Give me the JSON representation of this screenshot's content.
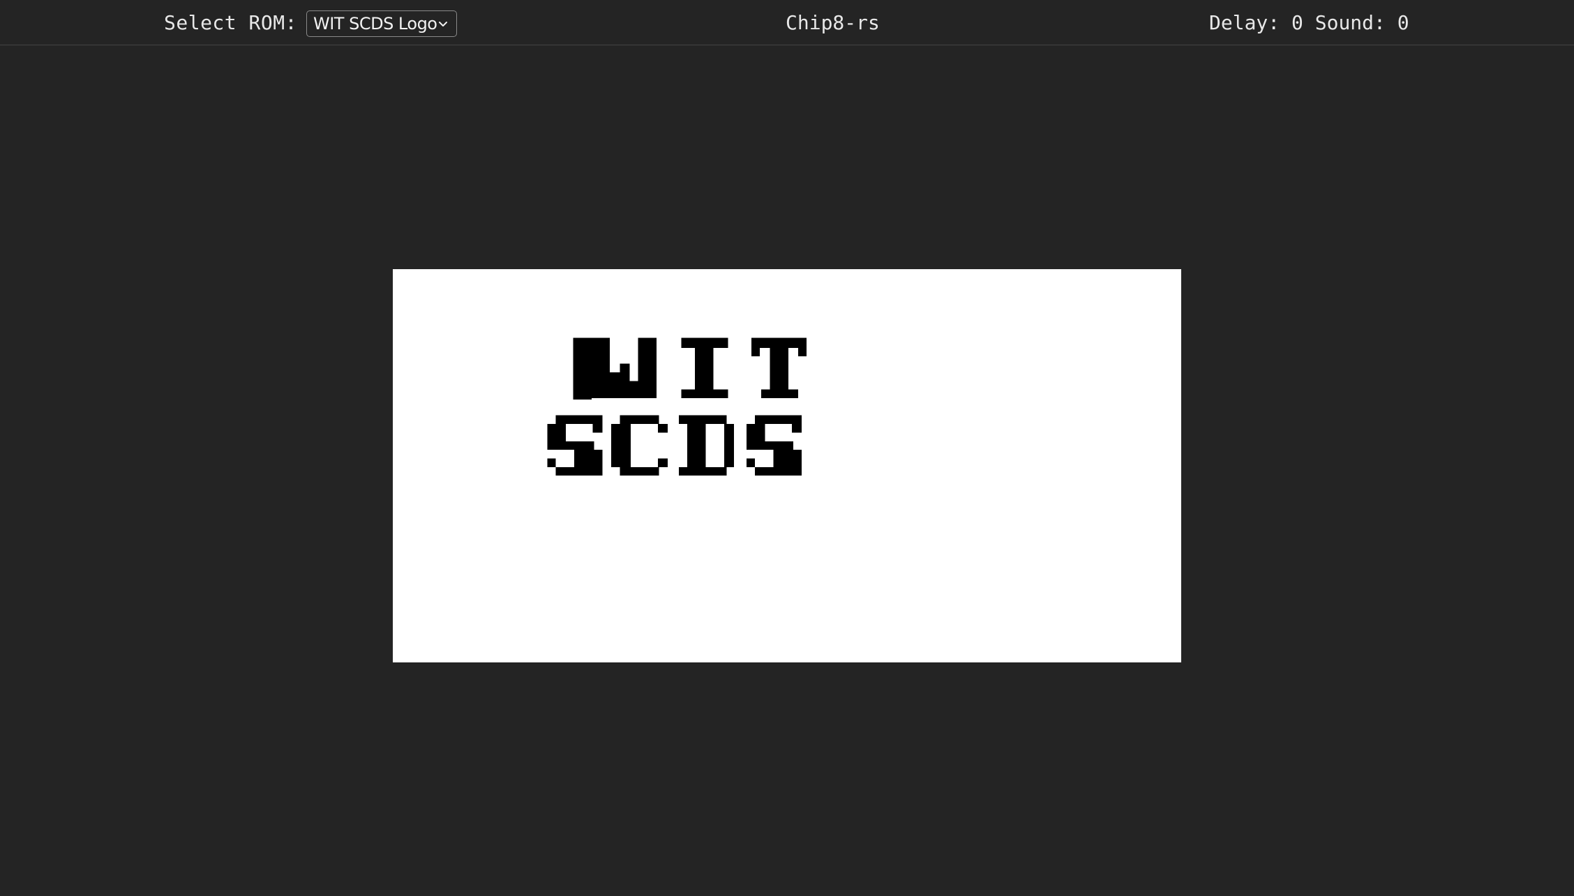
{
  "header": {
    "rom_label": "Select ROM:",
    "rom_selected": "WIT SCDS Logo",
    "app_title": "Chip8-rs",
    "delay_label": "Delay:",
    "delay_value": "0",
    "sound_label": "Sound:",
    "sound_value": "0"
  },
  "display": {
    "logo_text": "WIT SCDS",
    "background_color": "#ffffff",
    "pixel_color": "#000000"
  },
  "icons": {
    "rom_dropdown": "chevron-down-icon"
  }
}
